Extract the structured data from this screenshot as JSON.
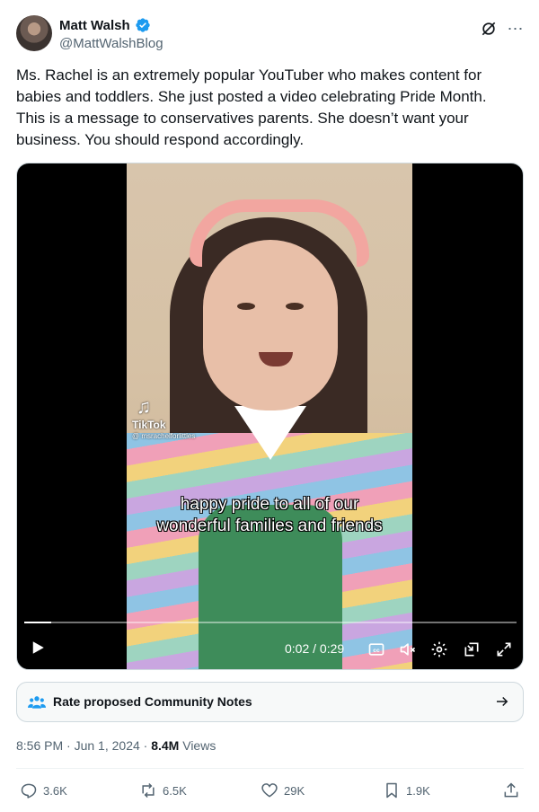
{
  "author": {
    "name": "Matt Walsh",
    "handle": "@MattWalshBlog",
    "verified": true,
    "accent": "#1d9bf0"
  },
  "tweet": {
    "text": "Ms. Rachel is an extremely popular YouTuber who makes content for babies and toddlers. She just posted a video celebrating Pride Month. This is a message to conservatives parents. She doesn’t want your business. You should respond accordingly."
  },
  "video": {
    "watermark_brand": "TikTok",
    "watermark_user": "@ msrachelforlittles",
    "caption": "happy pride to all of our wonderful families and friends",
    "time_display": "0:02 / 0:29",
    "progress_fraction": 0.055
  },
  "community_notes": {
    "label": "Rate proposed Community Notes"
  },
  "meta": {
    "time": "8:56 PM",
    "date": "Jun 1, 2024",
    "views_count": "8.4M",
    "views_label": "Views"
  },
  "actions": {
    "replies": "3.6K",
    "reposts": "6.5K",
    "likes": "29K",
    "bookmarks": "1.9K"
  }
}
